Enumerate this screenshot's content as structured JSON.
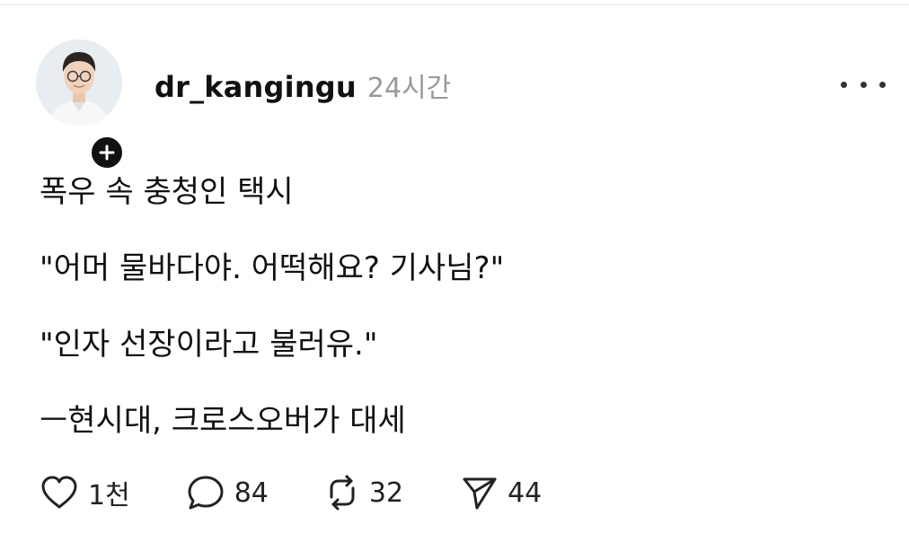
{
  "post": {
    "author": {
      "username": "dr_kangingu",
      "time_ago": "24시간"
    },
    "lines": [
      "폭우 속 충청인 택시",
      "\"어머 물바다야. 어떡해요? 기사님?\"",
      "\"인자 선장이라고 불러유.\"",
      "ㅡ현시대, 크로스오버가 대세"
    ],
    "actions": {
      "likes": "1천",
      "replies": "84",
      "reposts": "32",
      "shares": "44"
    }
  },
  "icons": {
    "follow": "plus-icon",
    "more": "more-horizontal-icon",
    "like": "heart-icon",
    "reply": "comment-bubble-icon",
    "repost": "repost-icon",
    "share": "send-icon"
  },
  "colors": {
    "text": "#111111",
    "muted": "#9a9a9a",
    "divider": "#eeeeee"
  }
}
